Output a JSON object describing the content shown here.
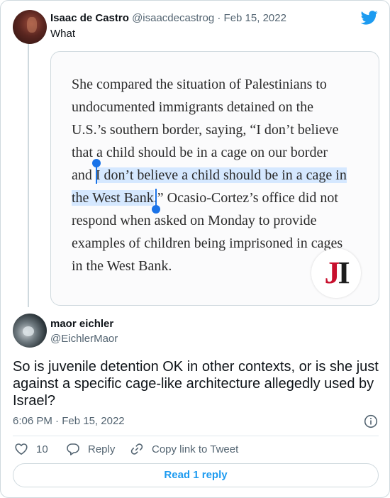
{
  "tweet1": {
    "name": "Isaac de Castro",
    "handle": "@isaacdecastrog",
    "separator": "·",
    "date": "Feb 15, 2022",
    "text": "What"
  },
  "quote_image": {
    "lines": [
      {
        "text": "She compared the situation of Palestinians to"
      },
      {
        "text": "undocumented immigrants detained on the"
      },
      {
        "text": "U.S.’s southern border, saying, “I don’t believe"
      },
      {
        "text": "that a child should be in a cage on our border"
      },
      {
        "pre": "and ",
        "highlight": "I don’t believe a child should be in a cage in"
      },
      {
        "highlight": "the West Bank",
        "post": ".” Ocasio-Cortez’s office did not"
      },
      {
        "text": "respond when asked on Monday to provide"
      },
      {
        "text": "examples of children being imprisoned in cages"
      },
      {
        "text": "in the West Bank."
      }
    ],
    "logo_j": "J",
    "logo_i": "I",
    "highlight_color": "#d5e8ff",
    "cursor_color": "#1a73e8"
  },
  "tweet2": {
    "name": "maor eichler",
    "handle": "@EichlerMaor",
    "text": "So is juvenile detention OK in other contexts, or is she just against a specific cage-like architecture allegedly used by Israel?",
    "time": "6:06 PM",
    "separator": "·",
    "date": "Feb 15, 2022"
  },
  "actions": {
    "like_count": "10",
    "reply_label": "Reply",
    "copy_label": "Copy link to Tweet"
  },
  "read_reply_label": "Read 1 reply",
  "icons": {
    "brand": "twitter-bird-icon",
    "info": "info-icon",
    "like": "heart-icon",
    "reply": "reply-bubble-icon",
    "copy": "link-icon"
  },
  "colors": {
    "twitter_blue": "#1d9bf0",
    "muted_text": "#536471",
    "border": "#cfd9de"
  }
}
